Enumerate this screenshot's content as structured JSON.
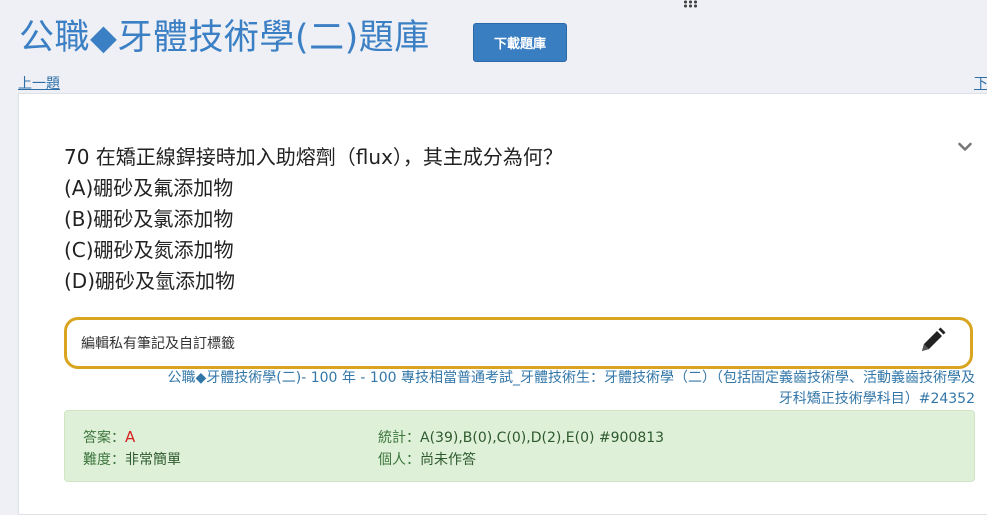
{
  "header": {
    "title": "公職◆牙體技術學(二)題庫",
    "download_button": "下載題庫"
  },
  "nav": {
    "prev": "上一題",
    "next": "下"
  },
  "question": {
    "text": "70 在矯正線銲接時加入助熔劑（flux），其主成分為何？",
    "options": [
      "(A)硼砂及氟添加物",
      "(B)硼砂及氯添加物",
      "(C)硼砂及氮添加物",
      "(D)硼砂及氫添加物"
    ]
  },
  "note": {
    "placeholder": "編輯私有筆記及自訂標籤"
  },
  "source": {
    "line1": "公職◆牙體技術學(二)- 100 年 - 100 專技相當普通考試_牙體技術生：牙體技術學（二）（包括固定義齒技術學、活動義齒技術學及",
    "line2": "牙科矯正技術學科目）#24352"
  },
  "answer_panel": {
    "answer_label": "答案：",
    "answer_value": "A",
    "difficulty_label": "難度：",
    "difficulty_value": "非常簡單",
    "stats_label": "統計：",
    "stats_value": "A(39),B(0),C(0),D(2),E(0) #900813",
    "personal_label": "個人：",
    "personal_value": "尚未作答"
  },
  "icons": {
    "grid": "grid-icon",
    "chevron": "chevron-down-icon",
    "pencil": "pencil-icon"
  },
  "colors": {
    "title": "#3b7fc4",
    "button": "#3a7ec2",
    "note_border": "#d9a520",
    "answer_bg": "#dff0d8",
    "answer_value": "#d42020"
  }
}
